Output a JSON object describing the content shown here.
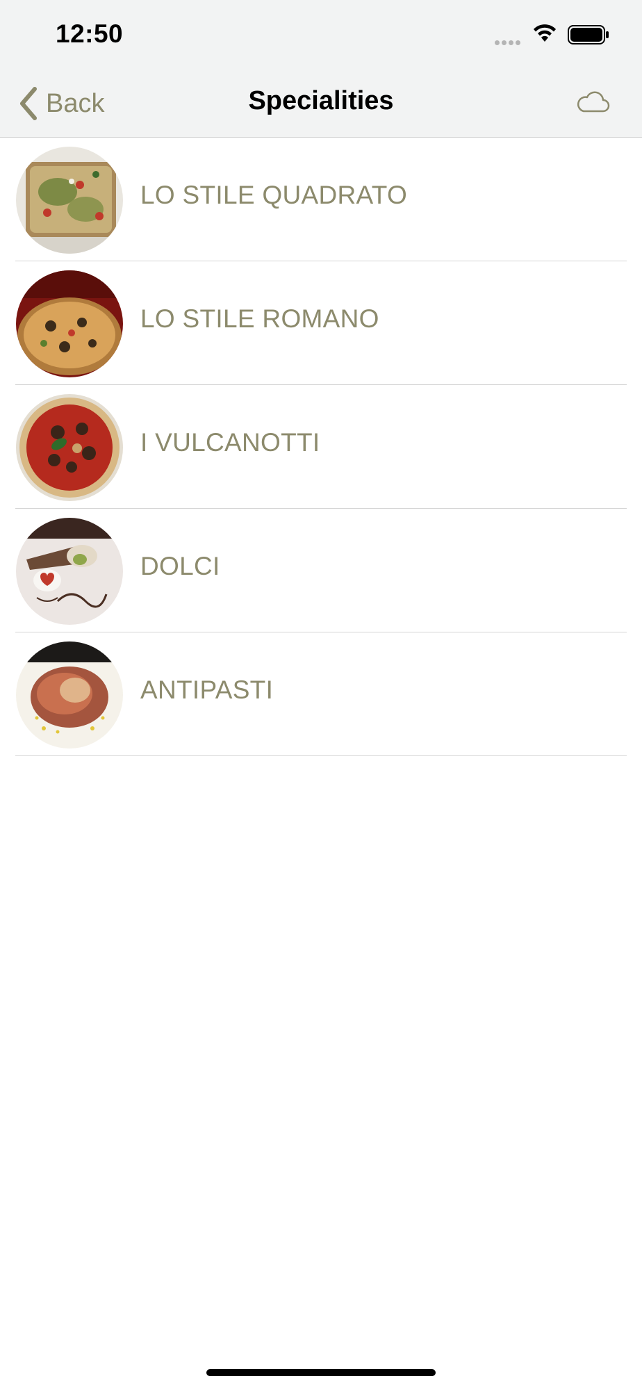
{
  "status_bar": {
    "time": "12:50",
    "signal_icon": "cellular-signal-icon",
    "wifi_icon": "wifi-icon",
    "battery_icon": "battery-icon"
  },
  "nav": {
    "back_label": "Back",
    "title": "Specialities",
    "cloud_icon": "cloud-icon"
  },
  "items": [
    {
      "label": "LO STILE QUADRATO",
      "image": "square-pizza-photo"
    },
    {
      "label": "LO STILE ROMANO",
      "image": "roman-pizza-photo"
    },
    {
      "label": "I VULCANOTTI",
      "image": "vulcanotti-pizza-photo"
    },
    {
      "label": "DOLCI",
      "image": "dessert-photo"
    },
    {
      "label": "ANTIPASTI",
      "image": "antipasto-photo"
    }
  ],
  "colors": {
    "accent": "#8c8a6c",
    "bar_background": "#f2f3f3"
  }
}
